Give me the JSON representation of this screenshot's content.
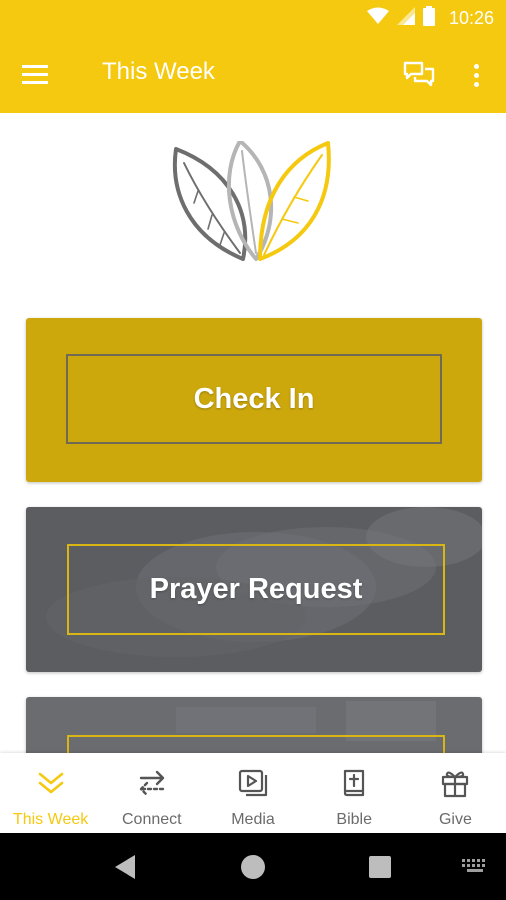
{
  "status_bar": {
    "time": "10:26",
    "icons": [
      "wifi-icon",
      "signal-icon",
      "battery-icon"
    ]
  },
  "app_bar": {
    "title": "This Week",
    "icons": [
      "menu-icon",
      "chat-icon",
      "more-vert-icon"
    ]
  },
  "cards": [
    {
      "label": "Check In"
    },
    {
      "label": "Prayer Request"
    },
    {
      "label": ""
    }
  ],
  "bottom_nav": {
    "items": [
      {
        "label": "This Week",
        "icon": "chevrons-down-icon",
        "active": true
      },
      {
        "label": "Connect",
        "icon": "swap-arrows-icon",
        "active": false
      },
      {
        "label": "Media",
        "icon": "media-play-icon",
        "active": false
      },
      {
        "label": "Bible",
        "icon": "bible-icon",
        "active": false
      },
      {
        "label": "Give",
        "icon": "gift-icon",
        "active": false
      }
    ]
  },
  "colors": {
    "brand_yellow": "#f5c90f",
    "check_in_card": "#cca80c",
    "prayer_card": "#5b5d61",
    "inactive_gray": "#6b6b6b"
  }
}
